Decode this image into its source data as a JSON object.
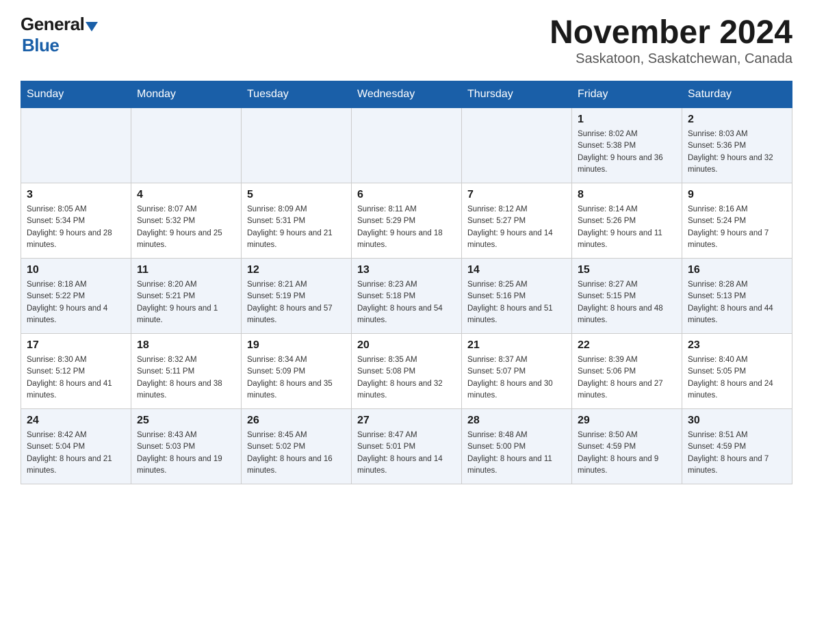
{
  "logo": {
    "general": "General",
    "blue": "Blue"
  },
  "header": {
    "month": "November 2024",
    "location": "Saskatoon, Saskatchewan, Canada"
  },
  "days_of_week": [
    "Sunday",
    "Monday",
    "Tuesday",
    "Wednesday",
    "Thursday",
    "Friday",
    "Saturday"
  ],
  "weeks": [
    [
      {
        "day": "",
        "info": ""
      },
      {
        "day": "",
        "info": ""
      },
      {
        "day": "",
        "info": ""
      },
      {
        "day": "",
        "info": ""
      },
      {
        "day": "",
        "info": ""
      },
      {
        "day": "1",
        "info": "Sunrise: 8:02 AM\nSunset: 5:38 PM\nDaylight: 9 hours and 36 minutes."
      },
      {
        "day": "2",
        "info": "Sunrise: 8:03 AM\nSunset: 5:36 PM\nDaylight: 9 hours and 32 minutes."
      }
    ],
    [
      {
        "day": "3",
        "info": "Sunrise: 8:05 AM\nSunset: 5:34 PM\nDaylight: 9 hours and 28 minutes."
      },
      {
        "day": "4",
        "info": "Sunrise: 8:07 AM\nSunset: 5:32 PM\nDaylight: 9 hours and 25 minutes."
      },
      {
        "day": "5",
        "info": "Sunrise: 8:09 AM\nSunset: 5:31 PM\nDaylight: 9 hours and 21 minutes."
      },
      {
        "day": "6",
        "info": "Sunrise: 8:11 AM\nSunset: 5:29 PM\nDaylight: 9 hours and 18 minutes."
      },
      {
        "day": "7",
        "info": "Sunrise: 8:12 AM\nSunset: 5:27 PM\nDaylight: 9 hours and 14 minutes."
      },
      {
        "day": "8",
        "info": "Sunrise: 8:14 AM\nSunset: 5:26 PM\nDaylight: 9 hours and 11 minutes."
      },
      {
        "day": "9",
        "info": "Sunrise: 8:16 AM\nSunset: 5:24 PM\nDaylight: 9 hours and 7 minutes."
      }
    ],
    [
      {
        "day": "10",
        "info": "Sunrise: 8:18 AM\nSunset: 5:22 PM\nDaylight: 9 hours and 4 minutes."
      },
      {
        "day": "11",
        "info": "Sunrise: 8:20 AM\nSunset: 5:21 PM\nDaylight: 9 hours and 1 minute."
      },
      {
        "day": "12",
        "info": "Sunrise: 8:21 AM\nSunset: 5:19 PM\nDaylight: 8 hours and 57 minutes."
      },
      {
        "day": "13",
        "info": "Sunrise: 8:23 AM\nSunset: 5:18 PM\nDaylight: 8 hours and 54 minutes."
      },
      {
        "day": "14",
        "info": "Sunrise: 8:25 AM\nSunset: 5:16 PM\nDaylight: 8 hours and 51 minutes."
      },
      {
        "day": "15",
        "info": "Sunrise: 8:27 AM\nSunset: 5:15 PM\nDaylight: 8 hours and 48 minutes."
      },
      {
        "day": "16",
        "info": "Sunrise: 8:28 AM\nSunset: 5:13 PM\nDaylight: 8 hours and 44 minutes."
      }
    ],
    [
      {
        "day": "17",
        "info": "Sunrise: 8:30 AM\nSunset: 5:12 PM\nDaylight: 8 hours and 41 minutes."
      },
      {
        "day": "18",
        "info": "Sunrise: 8:32 AM\nSunset: 5:11 PM\nDaylight: 8 hours and 38 minutes."
      },
      {
        "day": "19",
        "info": "Sunrise: 8:34 AM\nSunset: 5:09 PM\nDaylight: 8 hours and 35 minutes."
      },
      {
        "day": "20",
        "info": "Sunrise: 8:35 AM\nSunset: 5:08 PM\nDaylight: 8 hours and 32 minutes."
      },
      {
        "day": "21",
        "info": "Sunrise: 8:37 AM\nSunset: 5:07 PM\nDaylight: 8 hours and 30 minutes."
      },
      {
        "day": "22",
        "info": "Sunrise: 8:39 AM\nSunset: 5:06 PM\nDaylight: 8 hours and 27 minutes."
      },
      {
        "day": "23",
        "info": "Sunrise: 8:40 AM\nSunset: 5:05 PM\nDaylight: 8 hours and 24 minutes."
      }
    ],
    [
      {
        "day": "24",
        "info": "Sunrise: 8:42 AM\nSunset: 5:04 PM\nDaylight: 8 hours and 21 minutes."
      },
      {
        "day": "25",
        "info": "Sunrise: 8:43 AM\nSunset: 5:03 PM\nDaylight: 8 hours and 19 minutes."
      },
      {
        "day": "26",
        "info": "Sunrise: 8:45 AM\nSunset: 5:02 PM\nDaylight: 8 hours and 16 minutes."
      },
      {
        "day": "27",
        "info": "Sunrise: 8:47 AM\nSunset: 5:01 PM\nDaylight: 8 hours and 14 minutes."
      },
      {
        "day": "28",
        "info": "Sunrise: 8:48 AM\nSunset: 5:00 PM\nDaylight: 8 hours and 11 minutes."
      },
      {
        "day": "29",
        "info": "Sunrise: 8:50 AM\nSunset: 4:59 PM\nDaylight: 8 hours and 9 minutes."
      },
      {
        "day": "30",
        "info": "Sunrise: 8:51 AM\nSunset: 4:59 PM\nDaylight: 8 hours and 7 minutes."
      }
    ]
  ]
}
